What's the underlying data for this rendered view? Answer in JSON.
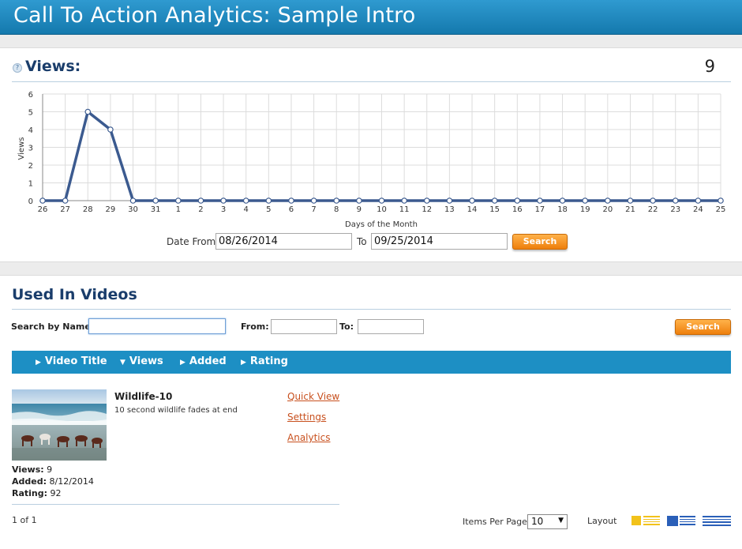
{
  "header": {
    "title": "Call To Action Analytics: Sample Intro"
  },
  "views_panel": {
    "help_icon": "?",
    "title": "Views:",
    "total": "9",
    "date_from_label": "Date From",
    "date_from_value": "08/26/2014",
    "to_label": "To",
    "date_to_value": "09/25/2014",
    "search_label": "Search"
  },
  "chart_data": {
    "type": "line",
    "categories": [
      "26",
      "27",
      "28",
      "29",
      "30",
      "31",
      "1",
      "2",
      "3",
      "4",
      "5",
      "6",
      "7",
      "8",
      "9",
      "10",
      "11",
      "12",
      "13",
      "14",
      "15",
      "16",
      "17",
      "18",
      "19",
      "20",
      "21",
      "22",
      "23",
      "24",
      "25"
    ],
    "series": [
      {
        "values": [
          0,
          0,
          5,
          4,
          0,
          0,
          0,
          0,
          0,
          0,
          0,
          0,
          0,
          0,
          0,
          0,
          0,
          0,
          0,
          0,
          0,
          0,
          0,
          0,
          0,
          0,
          0,
          0,
          0,
          0,
          0
        ]
      }
    ],
    "title": "",
    "xlabel": "Days of the Month",
    "ylabel": "Views",
    "ylim": [
      0,
      6
    ],
    "yticks": [
      0,
      1,
      2,
      3,
      4,
      5,
      6
    ],
    "grid": true,
    "line_color": "#3b5a8f"
  },
  "videos_panel": {
    "title": "Used In Videos",
    "search_by_name_label": "Search by Name:",
    "search_by_name_value": "",
    "from_label": "From:",
    "from_value": "",
    "to_label": "To:",
    "to_value": "",
    "search_label": "Search",
    "sort_columns": [
      {
        "label": "Video Title",
        "arrow": "▶"
      },
      {
        "label": "Views",
        "arrow": "▼"
      },
      {
        "label": "Added",
        "arrow": "▶"
      },
      {
        "label": "Rating",
        "arrow": "▶"
      }
    ],
    "video": {
      "title": "Wildlife-10",
      "description": "10 second wildlife fades at end",
      "links": [
        "Quick View",
        "Settings",
        "Analytics"
      ],
      "views_label": "Views:",
      "views_value": "9",
      "added_label": "Added:",
      "added_value": "8/12/2014",
      "rating_label": "Rating:",
      "rating_value": "92"
    },
    "pager": "1 of 1",
    "items_per_page_label": "Items Per Page",
    "items_per_page_value": "10",
    "layout_label": "Layout",
    "layout_icons": [
      "grid-layout-icon",
      "list-layout-icon",
      "compact-layout-icon"
    ]
  },
  "colors": {
    "header_blue": "#1d8fc4",
    "title_navy": "#1a3d6b",
    "button_orange": "#ee7f0c",
    "link_red": "#c8501e"
  }
}
